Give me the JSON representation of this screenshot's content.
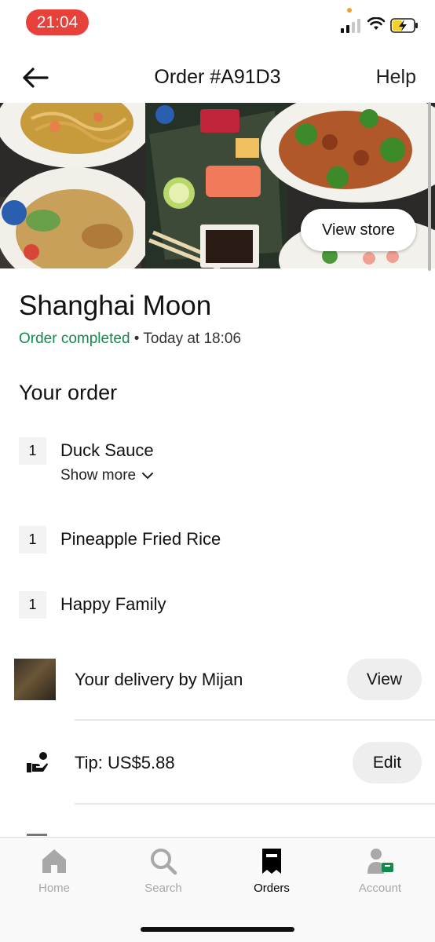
{
  "status_bar": {
    "time": "21:04"
  },
  "header": {
    "title": "Order #A91D3",
    "help_label": "Help"
  },
  "hero": {
    "view_store_label": "View store"
  },
  "store": {
    "name": "Shanghai Moon",
    "status": "Order completed",
    "separator": "•",
    "time": "Today at 18:06"
  },
  "order": {
    "section_title": "Your order",
    "items": [
      {
        "qty": "1",
        "name": "Duck Sauce",
        "show_more": "Show more"
      },
      {
        "qty": "1",
        "name": "Pineapple Fried Rice"
      },
      {
        "qty": "1",
        "name": "Happy Family"
      }
    ]
  },
  "delivery": {
    "text": "Your delivery by Mijan",
    "view_label": "View"
  },
  "tip": {
    "text": "Tip: US$5.88",
    "edit_label": "Edit"
  },
  "tabs": [
    {
      "label": "Home",
      "icon": "home-icon",
      "active": false
    },
    {
      "label": "Search",
      "icon": "search-icon",
      "active": false
    },
    {
      "label": "Orders",
      "icon": "receipt-icon",
      "active": true
    },
    {
      "label": "Account",
      "icon": "account-icon",
      "active": false
    }
  ],
  "colors": {
    "accent_green": "#138a4c",
    "status_time_pill": "#e8403a"
  }
}
